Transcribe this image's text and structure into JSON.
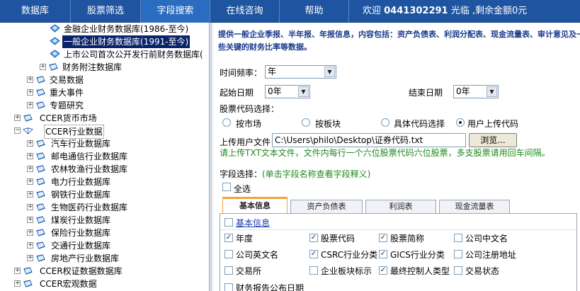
{
  "nav": {
    "items": [
      "数据库",
      "股票筛选",
      "字段搜索",
      "在线咨询",
      "帮助"
    ],
    "welcome_prefix": "欢迎 ",
    "user_id": "0441302291",
    "welcome_suffix": " 光临 ,剩余金额0元"
  },
  "tree": {
    "items": [
      {
        "label": "金融企业财务数据库(1986-至今)"
      },
      {
        "label": "一般企业财务数据库(1991-至今)"
      },
      {
        "label": "上市公司首次公开发行前财务数据库("
      },
      {
        "label": "财务附注数据库"
      },
      {
        "label": "交易数据"
      },
      {
        "label": "重大事件"
      },
      {
        "label": "专题研究"
      },
      {
        "label": "CCER货币市场"
      },
      {
        "label": "CCER行业数据"
      },
      {
        "label": "汽车行业数据库"
      },
      {
        "label": "邮电通信行业数据库"
      },
      {
        "label": "农林牧渔行业数据库"
      },
      {
        "label": "电力行业数据库"
      },
      {
        "label": "钢铁行业数据库"
      },
      {
        "label": "生物医药行业数据库"
      },
      {
        "label": "煤炭行业数据库"
      },
      {
        "label": "保险行业数据库"
      },
      {
        "label": "交通行业数据库"
      },
      {
        "label": "房地产行业数据库"
      },
      {
        "label": "CCER权证数据数据库"
      },
      {
        "label": "CCER宏观数据"
      }
    ]
  },
  "form": {
    "description": "提供一般企业季报、半年报、年报信息，内容包括：资产负债表、利润分配表、现金流量表、审计意见及一些关键的财务比率等数据。",
    "frequency_label": "时间频率：",
    "frequency_value": "年",
    "start_label": "起始日期",
    "start_value": "0年",
    "end_label": "结束日期",
    "end_value": "0年",
    "stock_code_label": "股票代码选择：",
    "radio_options": [
      "按市场",
      "按板块",
      "具体代码选择",
      "用户上传代码"
    ],
    "upload_label": "上传用户文件",
    "upload_value": "C:\\Users\\philo\\Desktop\\证券代码.txt",
    "browse_label": "浏览...",
    "upload_hint": "请上传TXT文本文件，文件内每行一个六位股票代码六位股票，多支股票请用回车间隔。",
    "field_label": "字段选择：",
    "field_hint": "(单击字段名称查看字段释义)",
    "select_all_label": "全选"
  },
  "tabs": [
    "基本信息",
    "资产负债表",
    "利润表",
    "现金流量表"
  ],
  "panel": {
    "group_title": "基本信息",
    "fields": [
      {
        "label": "年度",
        "checked": true
      },
      {
        "label": "股票代码",
        "checked": true
      },
      {
        "label": "股票简称",
        "checked": true
      },
      {
        "label": "公司中文名",
        "checked": false
      },
      {
        "label": "公司英文名",
        "checked": false
      },
      {
        "label": "CSRC行业分类",
        "checked": true
      },
      {
        "label": "GICS行业分类",
        "checked": true
      },
      {
        "label": "公司注册地址",
        "checked": false
      },
      {
        "label": "交易所",
        "checked": false
      },
      {
        "label": "企业板块标示",
        "checked": false
      },
      {
        "label": "最终控制人类型",
        "checked": true
      },
      {
        "label": "交易状态",
        "checked": false
      },
      {
        "label": "财务报告公布日期",
        "checked": false
      }
    ]
  },
  "colors": {
    "nav_bg": "#1f55a0",
    "selected_bg": "#0a246a",
    "hint_green": "#1f8a1f",
    "tab_accent": "#f2a33a"
  }
}
